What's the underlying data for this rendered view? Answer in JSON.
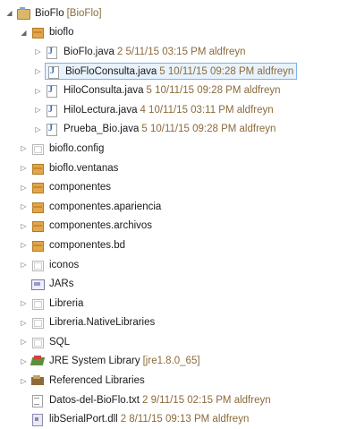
{
  "tree": {
    "rows": [
      {
        "level": 0,
        "twisty": "expanded",
        "icon": "project-icon",
        "label": "BioFlo",
        "decoration": "[BioFlo]",
        "meta": ""
      },
      {
        "level": 1,
        "twisty": "expanded",
        "icon": "package-icon",
        "label": "bioflo",
        "decoration": "",
        "meta": ""
      },
      {
        "level": 2,
        "twisty": "collapsed",
        "icon": "java-file-icon",
        "label": "BioFlo.java",
        "decoration": "",
        "meta": "2  5/11/15 03:15 PM  aldfreyn"
      },
      {
        "level": 2,
        "twisty": "collapsed",
        "icon": "java-file-icon",
        "label": "BioFloConsulta.java",
        "decoration": "",
        "meta": "5  10/11/15 09:28 PM  aldfreyn",
        "selected": true
      },
      {
        "level": 2,
        "twisty": "collapsed",
        "icon": "java-file-icon",
        "label": "HiloConsulta.java",
        "decoration": "",
        "meta": "5  10/11/15 09:28 PM  aldfreyn"
      },
      {
        "level": 2,
        "twisty": "collapsed",
        "icon": "java-file-icon",
        "label": "HiloLectura.java",
        "decoration": "",
        "meta": "4  10/11/15 03:11 PM  aldfreyn"
      },
      {
        "level": 2,
        "twisty": "collapsed",
        "icon": "java-file-icon",
        "label": "Prueba_Bio.java",
        "decoration": "",
        "meta": "5  10/11/15 09:28 PM  aldfreyn"
      },
      {
        "level": 1,
        "twisty": "collapsed",
        "icon": "package-empty-icon",
        "label": "bioflo.config",
        "decoration": "",
        "meta": ""
      },
      {
        "level": 1,
        "twisty": "collapsed",
        "icon": "package-icon",
        "label": "bioflo.ventanas",
        "decoration": "",
        "meta": ""
      },
      {
        "level": 1,
        "twisty": "collapsed",
        "icon": "package-icon",
        "label": "componentes",
        "decoration": "",
        "meta": ""
      },
      {
        "level": 1,
        "twisty": "collapsed",
        "icon": "package-icon",
        "label": "componentes.apariencia",
        "decoration": "",
        "meta": ""
      },
      {
        "level": 1,
        "twisty": "collapsed",
        "icon": "package-icon",
        "label": "componentes.archivos",
        "decoration": "",
        "meta": ""
      },
      {
        "level": 1,
        "twisty": "collapsed",
        "icon": "package-icon",
        "label": "componentes.bd",
        "decoration": "",
        "meta": ""
      },
      {
        "level": 1,
        "twisty": "collapsed",
        "icon": "package-empty-icon",
        "label": "iconos",
        "decoration": "",
        "meta": ""
      },
      {
        "level": 1,
        "twisty": "none",
        "icon": "jars-folder-icon",
        "label": "JARs",
        "decoration": "",
        "meta": ""
      },
      {
        "level": 1,
        "twisty": "collapsed",
        "icon": "package-empty-icon",
        "label": "Libreria",
        "decoration": "",
        "meta": ""
      },
      {
        "level": 1,
        "twisty": "collapsed",
        "icon": "package-empty-icon",
        "label": "Libreria.NativeLibraries",
        "decoration": "",
        "meta": ""
      },
      {
        "level": 1,
        "twisty": "collapsed",
        "icon": "package-empty-icon",
        "label": "SQL",
        "decoration": "",
        "meta": ""
      },
      {
        "level": 1,
        "twisty": "collapsed",
        "icon": "jre-library-icon",
        "label": "JRE System Library",
        "decoration": "[jre1.8.0_65]",
        "meta": ""
      },
      {
        "level": 1,
        "twisty": "collapsed",
        "icon": "referenced-libraries-icon",
        "label": "Referenced Libraries",
        "decoration": "",
        "meta": ""
      },
      {
        "level": 1,
        "twisty": "none",
        "icon": "text-file-icon",
        "label": "Datos-del-BioFlo.txt",
        "decoration": "",
        "meta": "2  9/11/15 02:15 PM  aldfreyn"
      },
      {
        "level": 1,
        "twisty": "none",
        "icon": "dll-file-icon",
        "label": "libSerialPort.dll",
        "decoration": "",
        "meta": "2  8/11/15 09:13 PM  aldfreyn"
      }
    ]
  },
  "colors": {
    "selection_border": "#7fb2e6",
    "selection_bg": "#e8f2fc",
    "decoration": "#8b6b3a"
  }
}
